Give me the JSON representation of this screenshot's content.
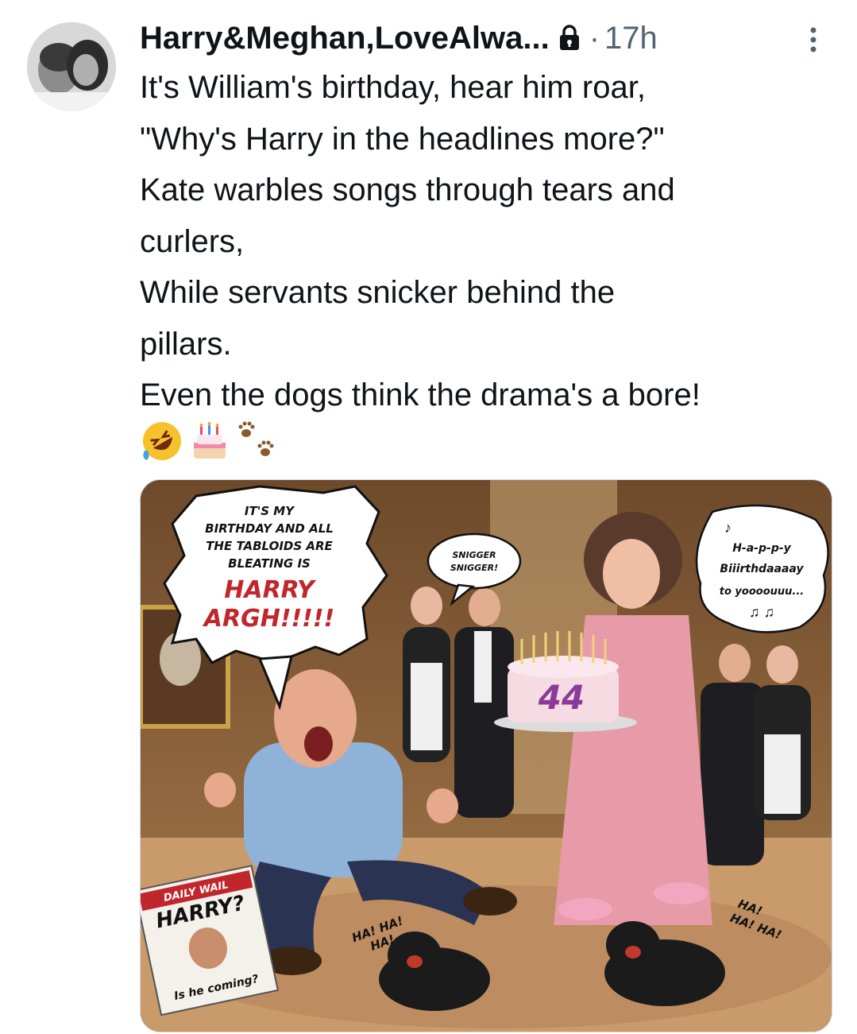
{
  "tweet": {
    "author_name": "Harry&Meghan,LoveAlwa...",
    "locked_icon": "lock-icon",
    "separator": "·",
    "timestamp": "17h",
    "more_icon": "more-vertical-icon",
    "lines": [
      "It's William's birthday, hear him roar,",
      "\"Why's Harry in the headlines more?\"",
      "Kate warbles songs through tears and",
      "curlers,",
      "While servants snicker behind the",
      "pillars.",
      "Even the dogs think the drama's a bore!"
    ],
    "emojis": [
      "rolling-on-floor-laughing-emoji",
      "birthday-cake-emoji",
      "paw-prints-emoji"
    ]
  },
  "media": {
    "speech_bubble_left": {
      "line1": "IT'S MY",
      "line2": "BIRTHDAY AND ALL",
      "line3": "THE TABLOIDS ARE",
      "line4": "BLEATING IS",
      "shout1": "HARRY",
      "shout2": "ARGH!!!!!"
    },
    "snigger_bubble": {
      "line1": "SNIGGER",
      "line2": "SNIGGER!"
    },
    "song_bubble": {
      "note_top": "♪",
      "line1": "H-a-p-p-y",
      "line2": "Biiirthdaaaay",
      "line3": "to yoooouuu...",
      "notes_bottom": "♫ ♫"
    },
    "cake_number": "44",
    "newspaper": {
      "masthead": "DAILY WAIL",
      "headline": "HARRY?",
      "caption": "Is he coming?"
    },
    "dog_left_laugh": {
      "line1": "HA! HA!",
      "line2": "HA!"
    },
    "dog_right_laugh": {
      "line1": "HA!",
      "line2": "HA! HA!"
    },
    "colors": {
      "cake_number": "#8a3a9a",
      "shout": "#c0262b",
      "robe": "#e79aa8",
      "shirt": "#8fb2d9",
      "carpet": "#c99a6a"
    }
  }
}
